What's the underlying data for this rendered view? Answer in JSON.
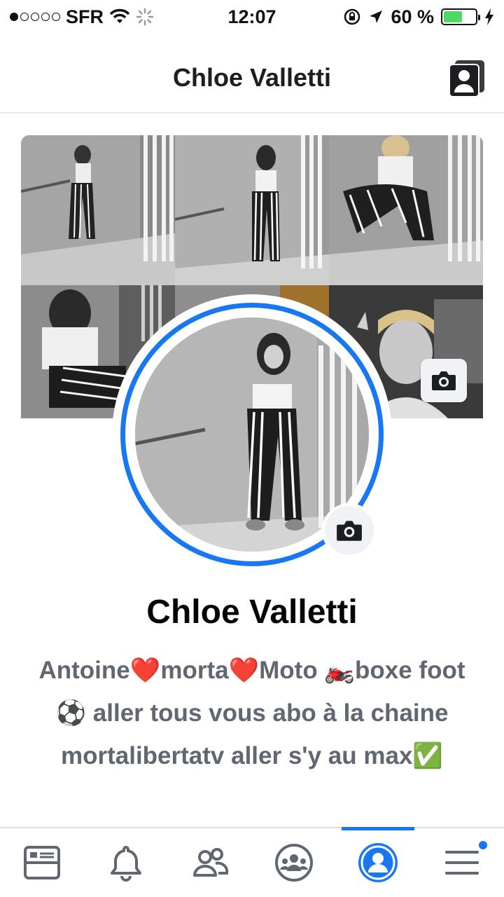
{
  "status_bar": {
    "carrier": "SFR",
    "time": "12:07",
    "battery_text": "60 %",
    "battery_level": 0.6,
    "signal_bars": 1,
    "signal_total": 5
  },
  "header": {
    "title": "Chloe Valletti",
    "icon": "photo-album-icon"
  },
  "cover": {
    "camera_icon": "camera-icon"
  },
  "avatar": {
    "camera_icon": "camera-icon",
    "ring_color": "#1877f2"
  },
  "profile": {
    "name": "Chloe Valletti",
    "bio": "Antoine❤️morta❤️Moto 🏍️boxe foot ⚽ aller tous vous abo à la chaine mortalibertatv aller s'y au max✅"
  },
  "tabs": [
    {
      "name": "news-feed-icon",
      "active": false
    },
    {
      "name": "notifications-bell-icon",
      "active": false
    },
    {
      "name": "friends-icon",
      "active": false
    },
    {
      "name": "groups-icon",
      "active": false
    },
    {
      "name": "profile-icon",
      "active": true
    },
    {
      "name": "menu-icon",
      "active": false,
      "badge": true
    }
  ],
  "colors": {
    "accent": "#1877f2",
    "secondary_text": "#606770",
    "icon": "#606770"
  }
}
